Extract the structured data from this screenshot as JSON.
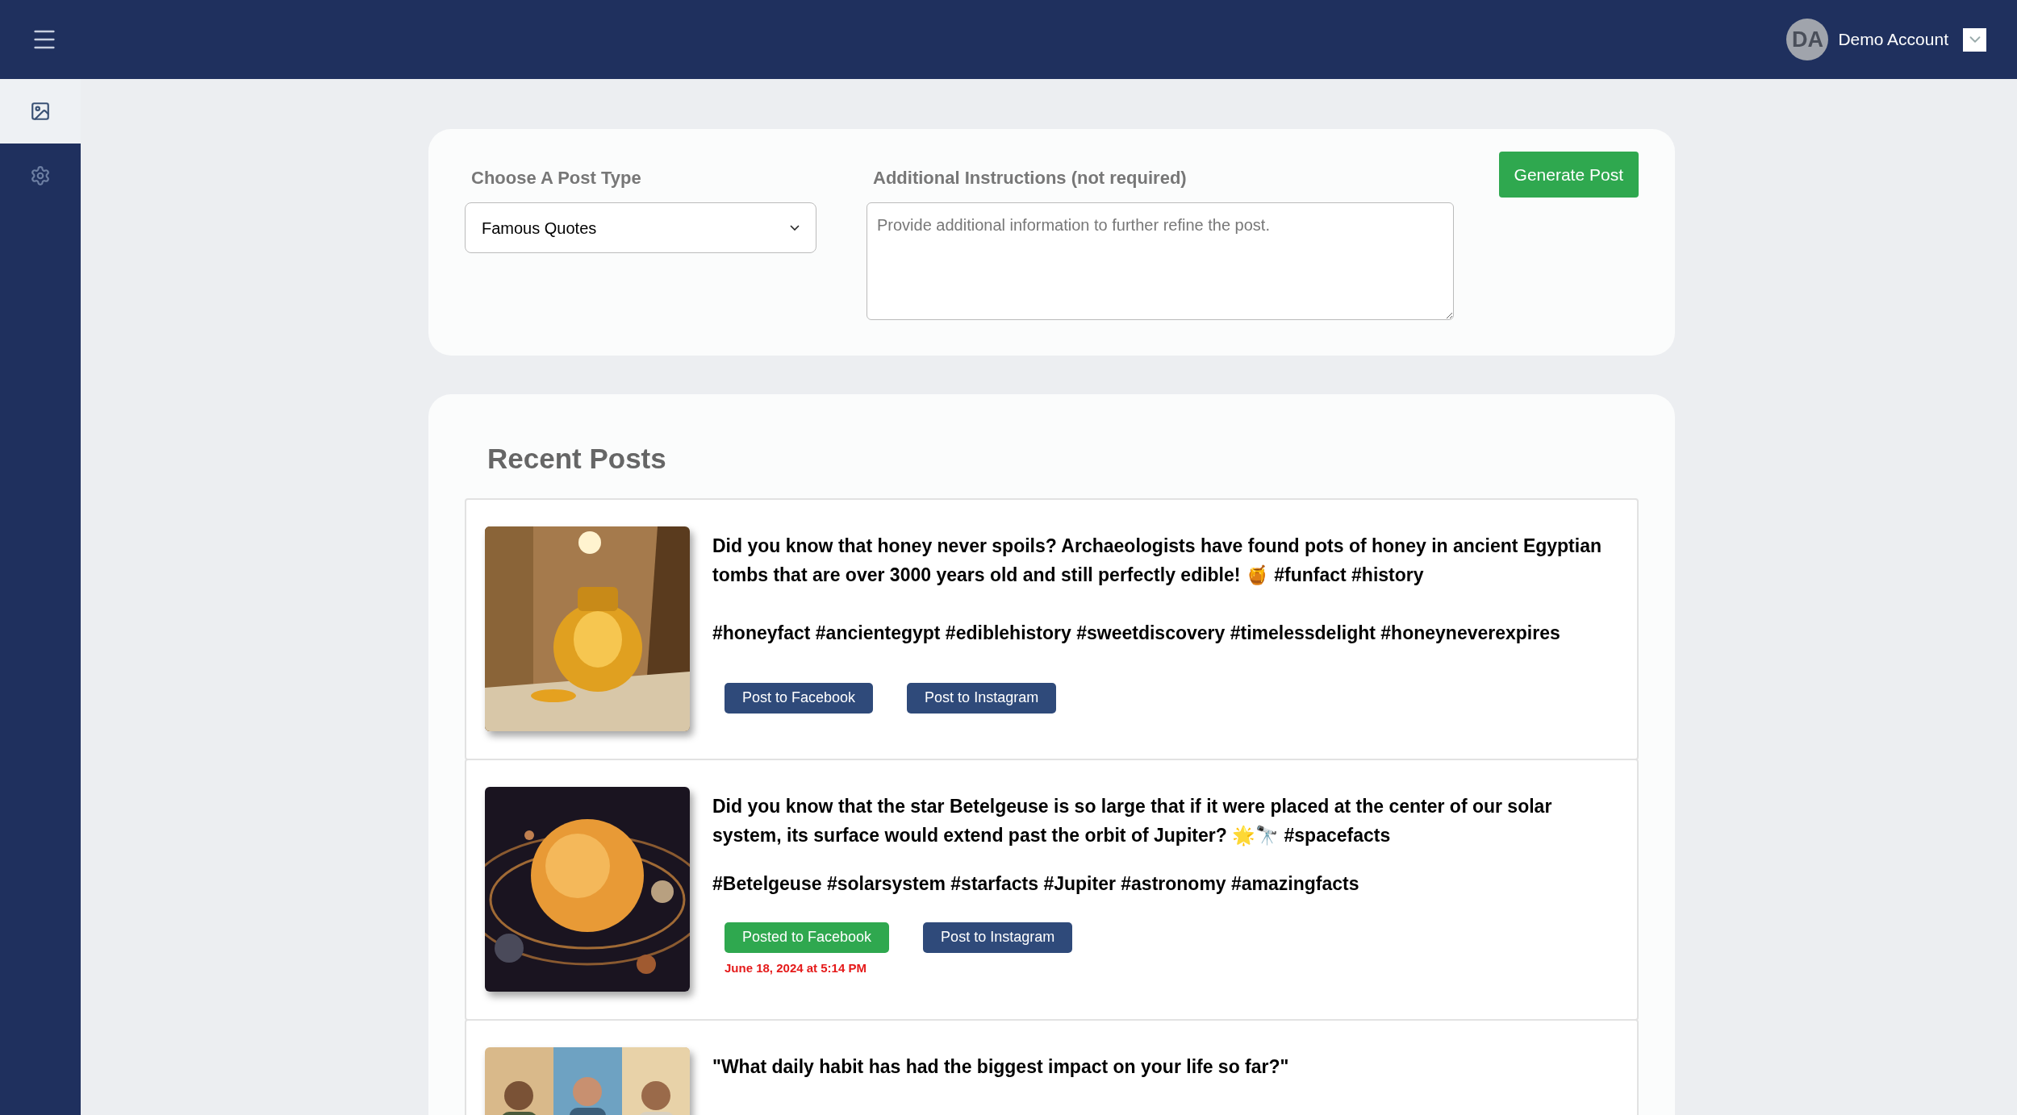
{
  "header": {
    "avatar_initials": "DA",
    "account_name": "Demo Account"
  },
  "sidebar": {
    "items": [
      {
        "kind": "images",
        "selected": true
      },
      {
        "kind": "settings",
        "selected": false
      }
    ]
  },
  "form": {
    "post_type_label": "Choose A Post Type",
    "post_type_value": "Famous Quotes",
    "instructions_label": "Additional Instructions (not required)",
    "instructions_placeholder": "Provide additional information to further refine the post.",
    "generate_button": "Generate Post"
  },
  "recent_posts": {
    "title": "Recent Posts",
    "posts": [
      {
        "image": {
          "kind": "picture"
        },
        "text": "Did you know that honey never spoils? Archaeologists have found pots of honey in ancient Egyptian tombs that are over 3000 years old and still perfectly edible! 🍯 #funfact #history",
        "hashtags": "#honeyfact #ancientegypt #ediblehistory #sweetdiscovery #timelessdelight #honeyneverexpires",
        "buttons": [
          {
            "label": "Post to Facebook",
            "posted": false
          },
          {
            "label": "Post to Instagram",
            "posted": false
          }
        ]
      },
      {
        "image": {
          "kind": "picture"
        },
        "text": "Did you know that the star Betelgeuse is so large that if it were placed at the center of our solar system, its surface would extend past the orbit of Jupiter? 🌟🔭 #spacefacts",
        "hashtags": "#Betelgeuse #solarsystem #starfacts #Jupiter #astronomy #amazingfacts",
        "buttons": [
          {
            "label": "Posted to Facebook",
            "posted": true,
            "posted_at": "June 18, 2024 at 5:14 PM"
          },
          {
            "label": "Post to Instagram",
            "posted": false
          }
        ]
      },
      {
        "image": {
          "kind": "picture"
        },
        "text": "\"What daily habit has had the biggest impact on your life so far?\""
      }
    ]
  }
}
